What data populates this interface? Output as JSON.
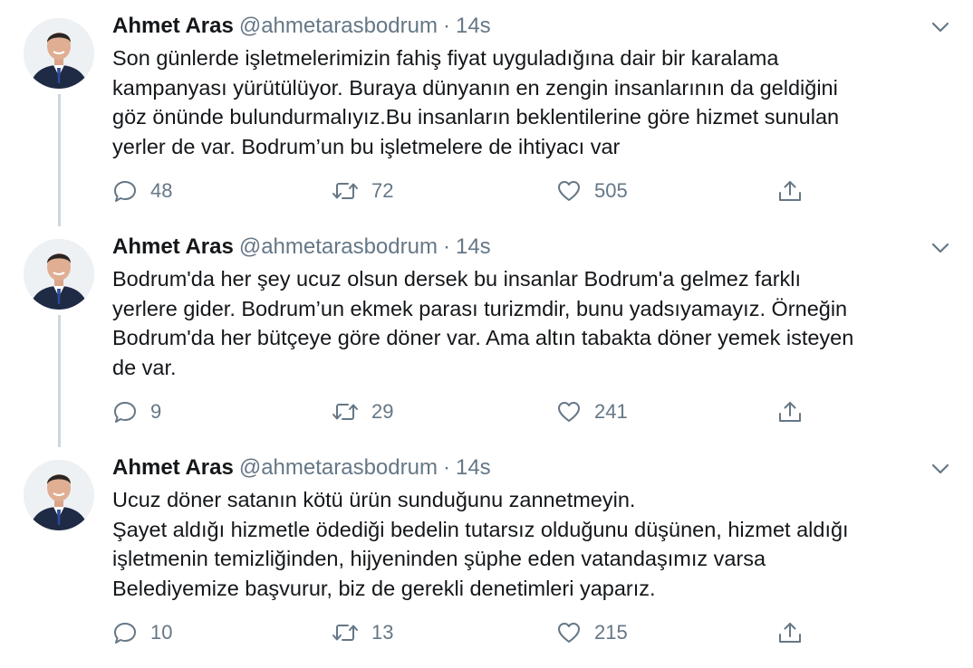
{
  "tweets": [
    {
      "name": "Ahmet Aras",
      "handle": "@ahmetarasbodrum",
      "time": "14s",
      "separator": "·",
      "lines": [
        "Son günlerde işletmelerimizin fahiş fiyat uyguladığına dair bir karalama",
        "kampanyası yürütülüyor. Buraya dünyanın en zengin insanlarının da geldiğini",
        "göz önünde bulundurmalıyız.Bu insanların beklentilerine göre hizmet sunulan",
        "yerler de var. Bodrum’un bu işletmelere de ihtiyacı var"
      ],
      "replies": "48",
      "retweets": "72",
      "likes": "505"
    },
    {
      "name": "Ahmet Aras",
      "handle": "@ahmetarasbodrum",
      "time": "14s",
      "separator": "·",
      "lines": [
        "Bodrum'da her şey ucuz olsun dersek bu insanlar Bodrum'a gelmez farklı",
        "yerlere gider. Bodrum’un ekmek parası turizmdir, bunu yadsıyamayız. Örneğin",
        "Bodrum'da her bütçeye göre döner var. Ama altın tabakta döner yemek isteyen",
        "de var."
      ],
      "replies": "9",
      "retweets": "29",
      "likes": "241"
    },
    {
      "name": "Ahmet Aras",
      "handle": "@ahmetarasbodrum",
      "time": "14s",
      "separator": "·",
      "lines": [
        "Ucuz döner satanın kötü ürün sunduğunu zannetmeyin.",
        "Şayet aldığı hizmetle ödediği bedelin tutarsız olduğunu düşünen, hizmet aldığı",
        "işletmenin temizliğinden, hijyeninden şüphe eden vatandaşımız varsa",
        "Belediyemize başvurur, biz de gerekli denetimleri yaparız."
      ],
      "replies": "10",
      "retweets": "13",
      "likes": "215"
    }
  ]
}
